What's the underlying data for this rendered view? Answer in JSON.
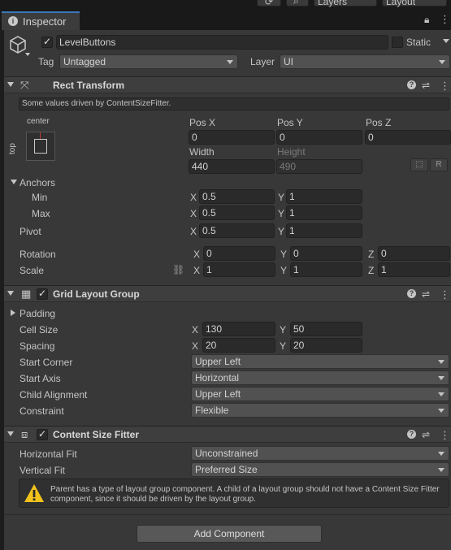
{
  "toolbar": {
    "layers_label": "Layers",
    "layout_label": "Layout"
  },
  "tab": {
    "label": "Inspector"
  },
  "gameobject": {
    "active": true,
    "name": "LevelButtons",
    "static_label": "Static",
    "static_checked": false,
    "tag_label": "Tag",
    "tag_value": "Untagged",
    "layer_label": "Layer",
    "layer_value": "UI"
  },
  "rect_transform": {
    "title": "Rect Transform",
    "info": "Some values driven by ContentSizeFitter.",
    "anchor_h": "center",
    "anchor_v": "top",
    "pos_x_label": "Pos X",
    "pos_x": "0",
    "pos_y_label": "Pos Y",
    "pos_y": "0",
    "pos_z_label": "Pos Z",
    "pos_z": "0",
    "width_label": "Width",
    "width": "440",
    "height_label": "Height",
    "height": "490",
    "raw_btn": "R",
    "anchors_label": "Anchors",
    "min_label": "Min",
    "min_x": "0.5",
    "min_y": "1",
    "max_label": "Max",
    "max_x": "0.5",
    "max_y": "1",
    "pivot_label": "Pivot",
    "pivot_x": "0.5",
    "pivot_y": "1",
    "rotation_label": "Rotation",
    "rot_x": "0",
    "rot_y": "0",
    "rot_z": "0",
    "scale_label": "Scale",
    "scale_x": "1",
    "scale_y": "1",
    "scale_z": "1",
    "axis_x": "X",
    "axis_y": "Y",
    "axis_z": "Z"
  },
  "grid_layout": {
    "title": "Grid Layout Group",
    "enabled": true,
    "padding_label": "Padding",
    "cell_size_label": "Cell Size",
    "cell_x": "130",
    "cell_y": "50",
    "spacing_label": "Spacing",
    "spacing_x": "20",
    "spacing_y": "20",
    "start_corner_label": "Start Corner",
    "start_corner": "Upper Left",
    "start_axis_label": "Start Axis",
    "start_axis": "Horizontal",
    "child_alignment_label": "Child Alignment",
    "child_alignment": "Upper Left",
    "constraint_label": "Constraint",
    "constraint": "Flexible"
  },
  "content_size_fitter": {
    "title": "Content Size Fitter",
    "enabled": true,
    "hfit_label": "Horizontal Fit",
    "hfit": "Unconstrained",
    "vfit_label": "Vertical Fit",
    "vfit": "Preferred Size",
    "warning": "Parent has a type of layout group component. A child of a layout group should not have a Content Size Fitter component, since it should be driven by the layout group."
  },
  "add_component_label": "Add Component",
  "colors": {
    "panel_bg": "#383838",
    "header_bg": "#3e3e3e",
    "field_bg": "#2a2a2a",
    "dropdown_bg": "#515151",
    "tab_accent": "#3a79bb",
    "warning_yellow": "#f2c21b",
    "anchor_red": "#c0392b"
  }
}
